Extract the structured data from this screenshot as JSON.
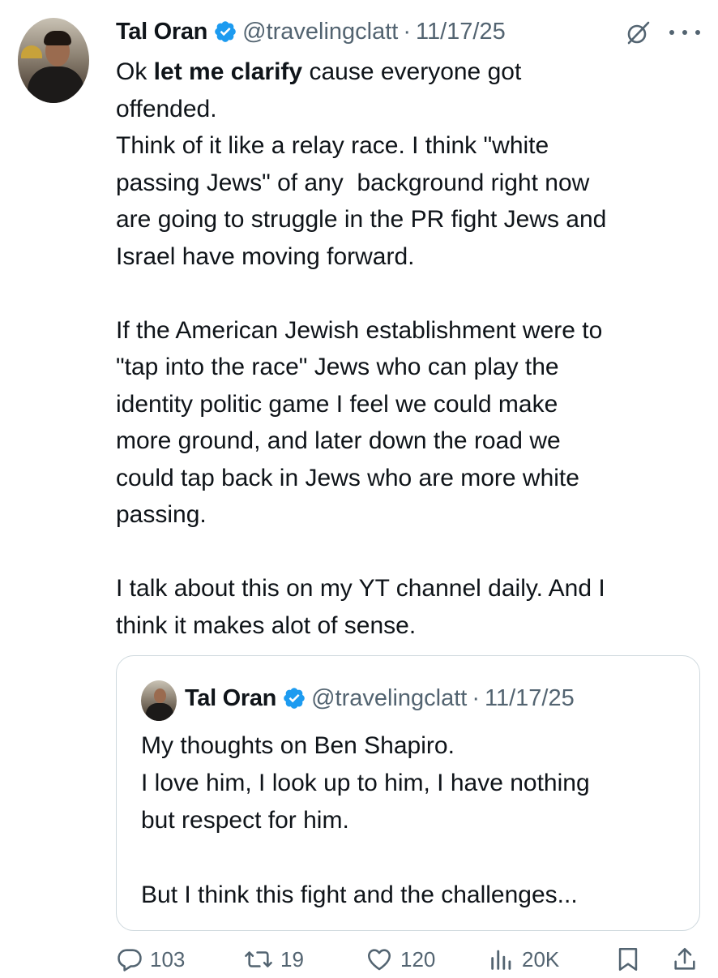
{
  "tweet": {
    "author_name": "Tal Oran",
    "handle": "@travelingclatt",
    "separator": "·",
    "date": "11/17/25",
    "text_line1_pre": "Ok ",
    "text_line1_bold": "let me clarify",
    "text_line1_post": " cause everyone got",
    "text_line2": "offended.",
    "text_line3": "Think of it like a relay race. I think \"white",
    "text_line4": "passing Jews\" of any  background right now",
    "text_line5": "are going to struggle in the PR fight Jews and",
    "text_line6": "Israel have moving forward.",
    "text_line7": "If the American Jewish establishment were to",
    "text_line8": "\"tap into the race\" Jews who can play the",
    "text_line9": "identity politic game I feel we could make",
    "text_line10": "more ground, and later down the road we",
    "text_line11": "could tap back in Jews who are more white",
    "text_line12": "passing.",
    "text_line13": "I talk about this on my YT channel daily. And I",
    "text_line14": "think it makes alot of sense."
  },
  "quote": {
    "author_name": "Tal Oran",
    "handle": "@travelingclatt",
    "separator": "·",
    "date": "11/17/25",
    "line1": "My thoughts on Ben Shapiro.",
    "line2": "I love him, I look up to him, I have nothing",
    "line3": "but respect for him.",
    "line4": "But I think this fight and the challenges..."
  },
  "actions": {
    "replies": "103",
    "reposts": "19",
    "likes": "120",
    "views": "20K"
  },
  "icons": {
    "verified": "verified-badge-icon",
    "grok": "grok-icon",
    "more": "more-icon",
    "reply": "reply-icon",
    "repost": "repost-icon",
    "like": "like-icon",
    "views": "views-icon",
    "bookmark": "bookmark-icon",
    "share": "share-icon"
  },
  "colors": {
    "verified": "#1d9bf0",
    "text": "#0f1419",
    "secondary": "#536471",
    "border": "#cfd9de"
  }
}
